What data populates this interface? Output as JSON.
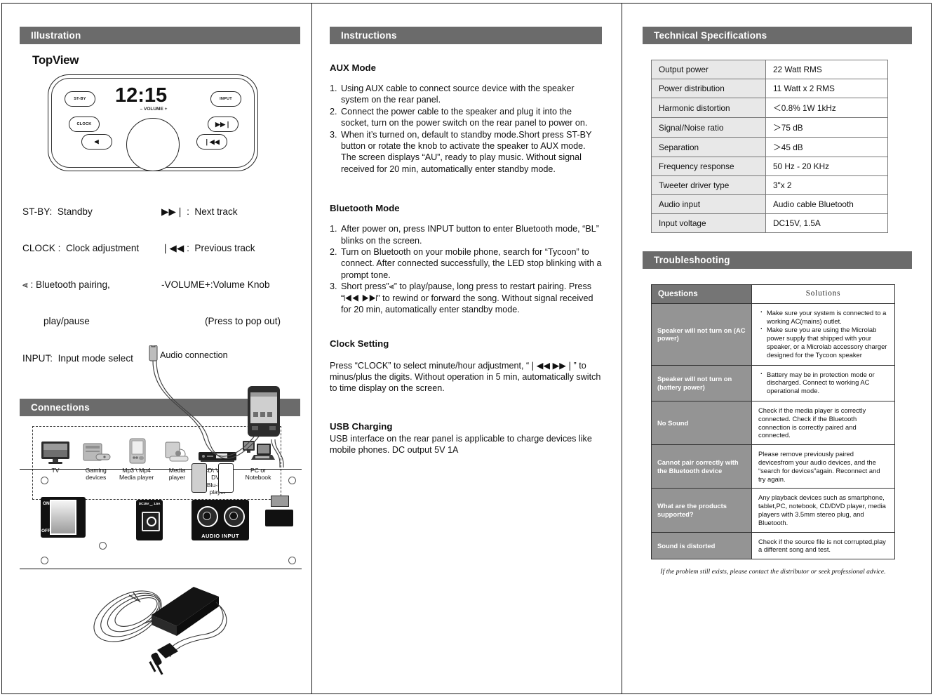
{
  "sections": {
    "illustration": "Illustration",
    "connections": "Connections",
    "instructions": "Instructions",
    "tech_specs": "Technical Specifications",
    "troubleshooting": "Troubleshooting"
  },
  "illustration": {
    "top_view_label": "TopView",
    "device": {
      "clock_display": "12:15",
      "buttons": {
        "stby": "ST-BY",
        "input": "INPUT",
        "clock": "CLOCK",
        "next": "▶▶❘",
        "prev": "❘◀◀",
        "bluetooth": "⫷"
      },
      "volume_label": "–  VOLUME  +"
    },
    "legend_left": [
      "ST-BY:  Standby",
      "CLOCK :  Clock adjustment",
      "⫷ : Bluetooth pairing,",
      "play/pause",
      "INPUT:  Input mode select"
    ],
    "legend_right": [
      "▶▶❘ :  Next track",
      "❘◀◀ :  Previous track",
      "-VOLUME+:Volume Knob",
      "(Press to pop out)"
    ]
  },
  "connections": {
    "devices": [
      {
        "icon": "tv-icon",
        "label": "TV"
      },
      {
        "icon": "gaming-console-icon",
        "label": "Gaming\ndevices"
      },
      {
        "icon": "mp3-player-icon",
        "label": "Mp3 \\ Mp4\nMedia player"
      },
      {
        "icon": "media-player-icon",
        "label": "Media\nplayer"
      },
      {
        "icon": "disc-player-icon",
        "label": "CD\\ VCD \\ DVD\nBlu-Ray player"
      },
      {
        "icon": "computer-icon",
        "label": "PC or\nNotebook"
      }
    ],
    "audio_connection_label": "Audio connection",
    "rear_panel": {
      "switch_on": "ON",
      "switch_off": "OFF",
      "dc_jack_label": "DC15V ⏝ 1.5A",
      "jack_labels": "AUDIO  INPUT"
    }
  },
  "instructions": {
    "aux": {
      "heading": "AUX Mode",
      "items": [
        {
          "num": "1.",
          "text": "Using AUX cable to connect source device with the speaker system on the rear panel."
        },
        {
          "num": "2.",
          "text": "Connect the power cable to the speaker and plug it into the socket, turn on the power switch on the rear panel to power on."
        },
        {
          "num": "3.",
          "text": "When it’s turned on, default to standby mode.Short press ST-BY button or rotate the knob to activate the speaker to AUX mode. The screen displays “AU”, ready to play music. Without signal received for 20 min, automatically enter standby mode."
        }
      ]
    },
    "bluetooth": {
      "heading": "Bluetooth Mode",
      "items": [
        {
          "num": "1.",
          "text": "After power on, press INPUT button to enter Bluetooth mode, “BL” blinks on the screen."
        },
        {
          "num": "2.",
          "text": "Turn on Bluetooth on your mobile phone, search for “Tycoon” to connect. After connected successfully, the LED stop blinking with a prompt tone."
        },
        {
          "num": "3.",
          "text": "Short press”⫷”  to play/pause, long press to restart pairing. Press “❘◀◀ ▶▶❘” to rewind or forward the song. Without signal received for 20 min, automatically enter standby mode."
        }
      ]
    },
    "clock": {
      "heading": "Clock Setting",
      "body": "Press “CLOCK” to select minute/hour adjustment, “❘◀◀ ▶▶❘”  to minus/plus the digits. Without operation in 5 min, automatically switch to time display on the screen."
    },
    "usb": {
      "heading": "USB Charging",
      "body": "USB interface on the rear panel is applicable to charge devices like mobile phones. DC output 5V 1A"
    }
  },
  "tech_specs": {
    "rows": [
      {
        "key": "Output power",
        "value": " 22 Watt RMS"
      },
      {
        "key": "Power distribution",
        "value": "11 Watt x 2 RMS"
      },
      {
        "key": "Harmonic distortion",
        "value": "＜0.8% 1W 1kHz"
      },
      {
        "key": "Signal/Noise ratio",
        "value": "＞75 dB"
      },
      {
        "key": "Separation",
        "value": "＞45 dB"
      },
      {
        "key": "Frequency response",
        "value": "50 Hz - 20 KHz"
      },
      {
        "key": "Tweeter driver type",
        "value": "3\"x 2"
      },
      {
        "key": "Audio input",
        "value": "Audio cable    Bluetooth"
      },
      {
        "key": "Input voltage",
        "value": "DC15V, 1.5A"
      }
    ]
  },
  "troubleshooting": {
    "header": {
      "question": "Questions",
      "solution": "Solutions"
    },
    "rows": [
      {
        "question": "Speaker will not turn on (AC power)",
        "bullets": [
          "Make sure your system is connected to a working AC(mains) outlet.",
          "Make sure you are using the Microlab power supply that shipped with your speaker, or a Microlab accessory charger designed for the Tycoon speaker"
        ],
        "solution": ""
      },
      {
        "question": "Speaker will not turn on (battery power)",
        "bullets": [
          "Battery may be in protection mode or discharged. Connect to working AC operational mode."
        ],
        "solution": ""
      },
      {
        "question": "No Sound",
        "bullets": [],
        "solution": "Check if the media player is correctly connected. Check if the Bluetooth connection is correctly paired and connected."
      },
      {
        "question": "Cannot pair correctly with the Bluetooth device",
        "bullets": [],
        "solution": "Please remove previously paired devicesfrom your audio devices, and the “search for devices”again. Reconnect and try again."
      },
      {
        "question": "What are the products supported?",
        "bullets": [],
        "solution": "Any playback devices such as smartphone, tablet,PC, notebook, CD/DVD player, media players with 3.5mm stereo plug, and Bluetooth."
      },
      {
        "question": "Sound is distorted",
        "bullets": [],
        "solution": "Check if the source file is not corrupted,play a different song and test."
      }
    ],
    "footnote": "If the problem still exists, please contact the distributor or seek professional advice."
  },
  "colors": {
    "section_bar": "#6b6b6b",
    "question_header": "#757575",
    "question_cell": "#949494",
    "spec_key_cell": "#e8e8e8",
    "ink": "#111111"
  }
}
